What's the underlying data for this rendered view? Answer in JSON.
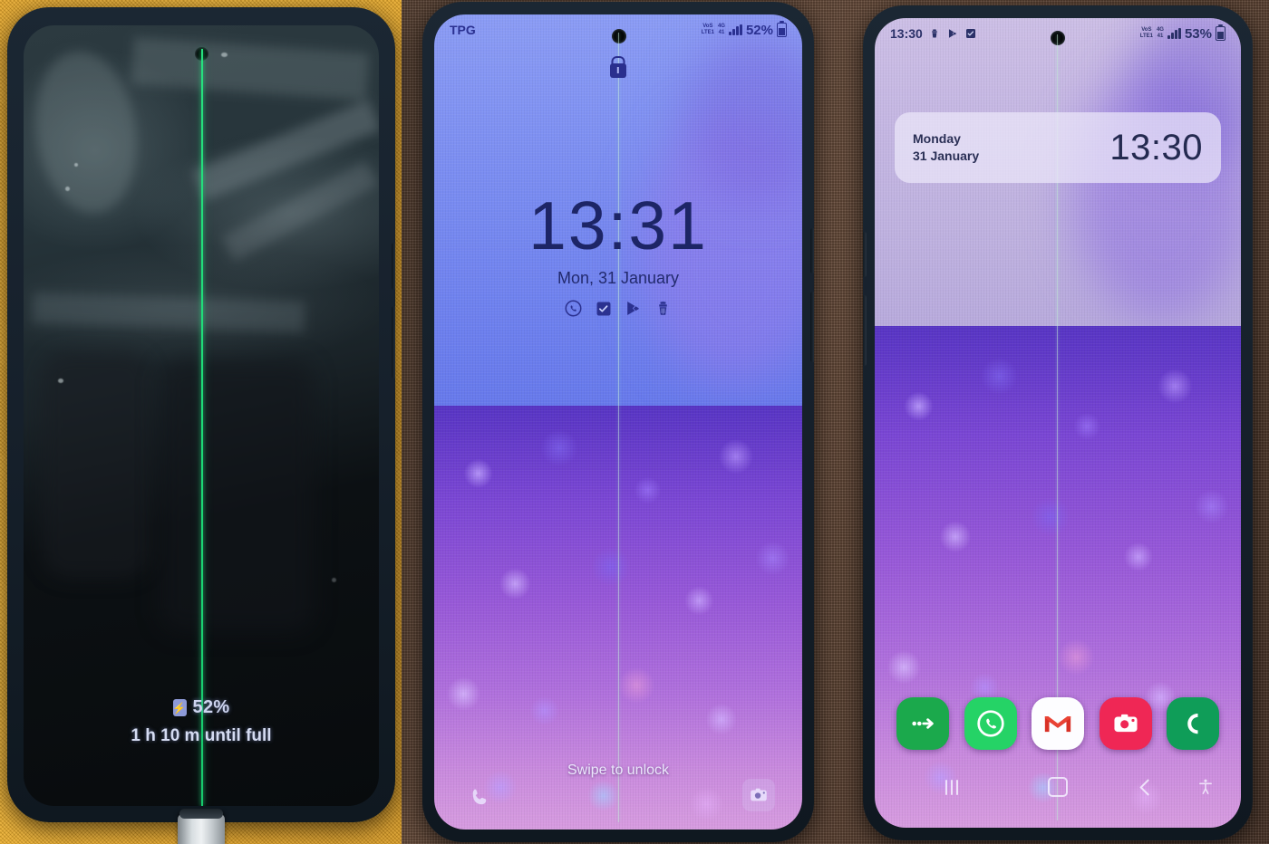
{
  "scene": {
    "title": "Three Samsung Galaxy S20 FE phones on fabric showing a green vertical display line defect",
    "background_left_color": "#e8a828",
    "background_right_color": "#5b4436",
    "defect_color": "#22de7d"
  },
  "phone_left": {
    "name": "Left phone — screen off while charging",
    "state": "screen-off-charging",
    "battery_percent": "52%",
    "charge_eta": "1 h 10 m until full",
    "battery_icon": "charging-bolt-battery-icon",
    "cable": "usb-c-cable",
    "has_green_line": true
  },
  "phone_mid": {
    "name": "Middle phone — lock screen",
    "statusbar": {
      "carrier": "TPG",
      "volte_label_top": "VoS",
      "volte_label_bottom": "LTE1",
      "network_top": "4G",
      "network_bottom": "41",
      "signal_icon": "signal-bars-icon",
      "battery_percent": "52%",
      "battery_icon": "battery-icon"
    },
    "lock_icon": "lock-icon",
    "clock": "13:31",
    "date": "Mon, 31 January",
    "notification_icons": [
      "whatsapp-icon",
      "checkbox-icon",
      "play-store-icon",
      "clean-broom-icon"
    ],
    "swipe_hint": "Swipe to unlock",
    "shortcut_left": "phone-icon",
    "shortcut_right": "camera-icon",
    "has_green_line": true
  },
  "phone_right": {
    "name": "Right phone — home screen",
    "statusbar": {
      "time": "13:30",
      "notification_icons": [
        "clean-broom-icon",
        "play-store-icon",
        "checkbox-icon"
      ],
      "volte_label_top": "VoS",
      "volte_label_bottom": "LTE1",
      "network_top": "4G",
      "network_bottom": "41",
      "signal_icon": "signal-bars-icon",
      "battery_percent": "53%",
      "battery_icon": "battery-icon"
    },
    "clock_widget": {
      "day": "Monday",
      "month_day": "31 January",
      "time": "13:30"
    },
    "dock_apps": [
      {
        "name": "messages-icon",
        "color": "#1ba94c"
      },
      {
        "name": "whatsapp-icon",
        "color": "#25d366"
      },
      {
        "name": "gmail-icon",
        "color": "#ffffff"
      },
      {
        "name": "instagram-camera-icon",
        "color": "#ef2755"
      },
      {
        "name": "phone-icon",
        "color": "#0f9d58"
      }
    ],
    "navbar": {
      "recents": "recents-icon",
      "home": "home-icon",
      "back": "back-icon",
      "accessibility": "accessibility-icon"
    },
    "has_green_line": true
  }
}
